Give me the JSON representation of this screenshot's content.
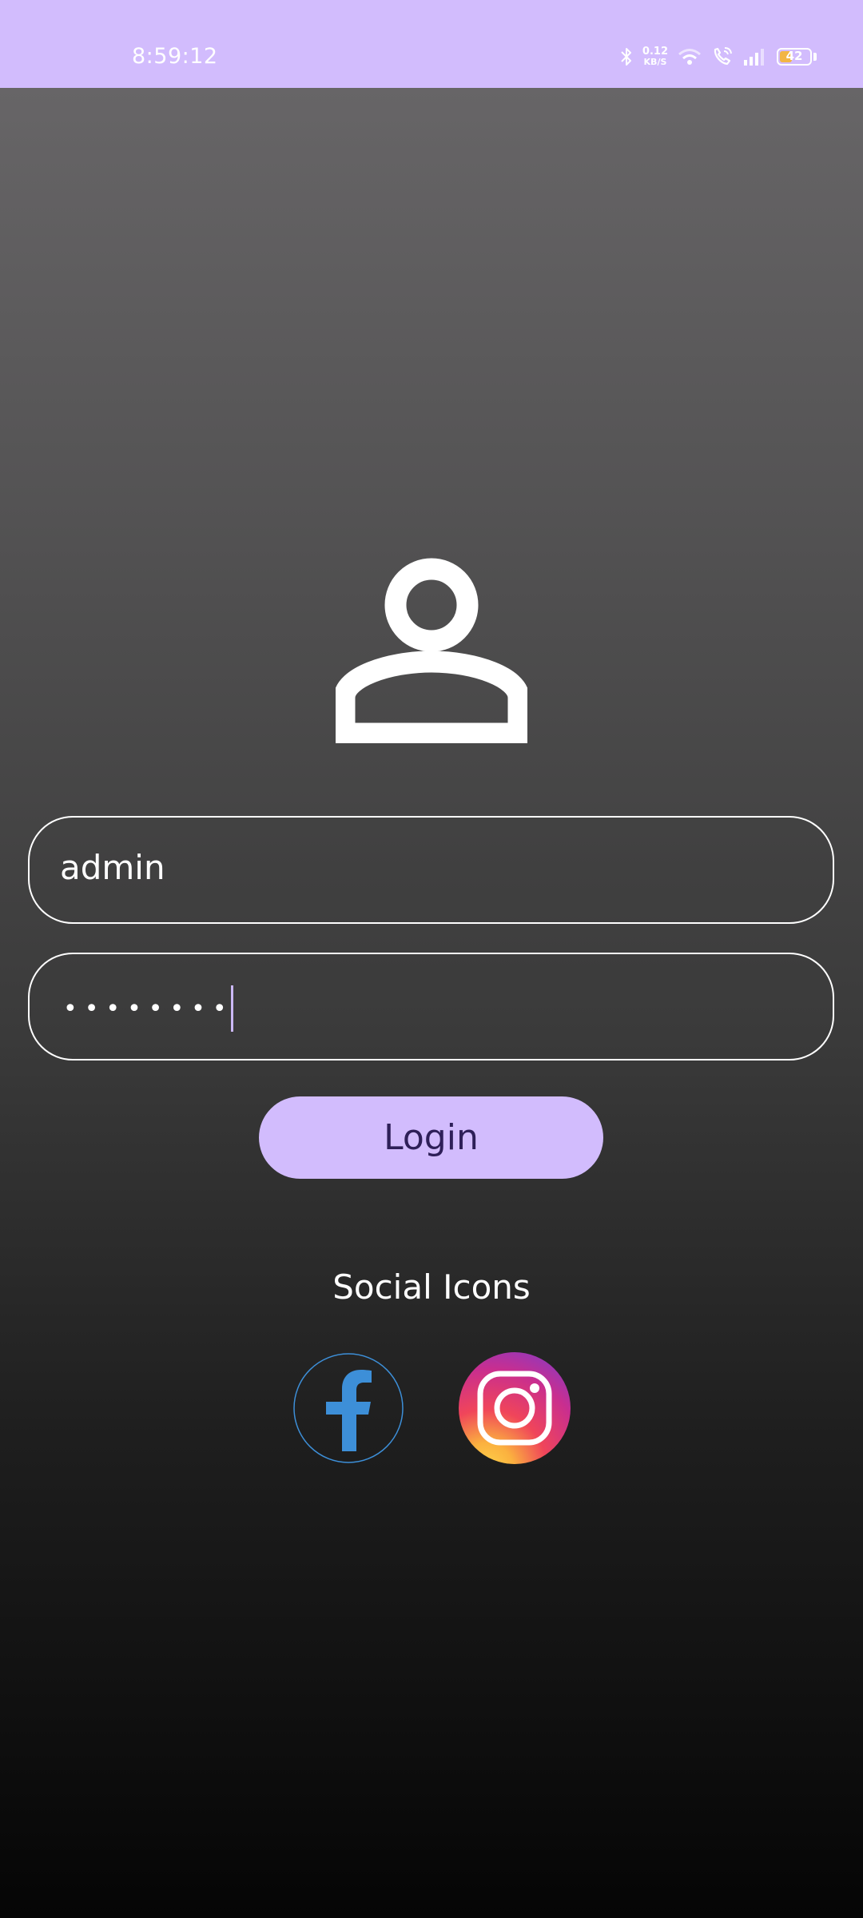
{
  "status_bar": {
    "time": "8:59:12",
    "speed_value": "0.12",
    "speed_unit": "KB/S",
    "battery_level": "42",
    "battery_fraction": 0.42,
    "background_color": "#d2bcfd"
  },
  "login": {
    "avatar_icon": "user-icon",
    "username_value": "admin",
    "password_value": "••••••••",
    "button_label": "Login",
    "button_color": "#d2bcfd"
  },
  "social": {
    "title": "Social Icons",
    "icons": [
      "facebook-icon",
      "instagram-icon"
    ]
  }
}
